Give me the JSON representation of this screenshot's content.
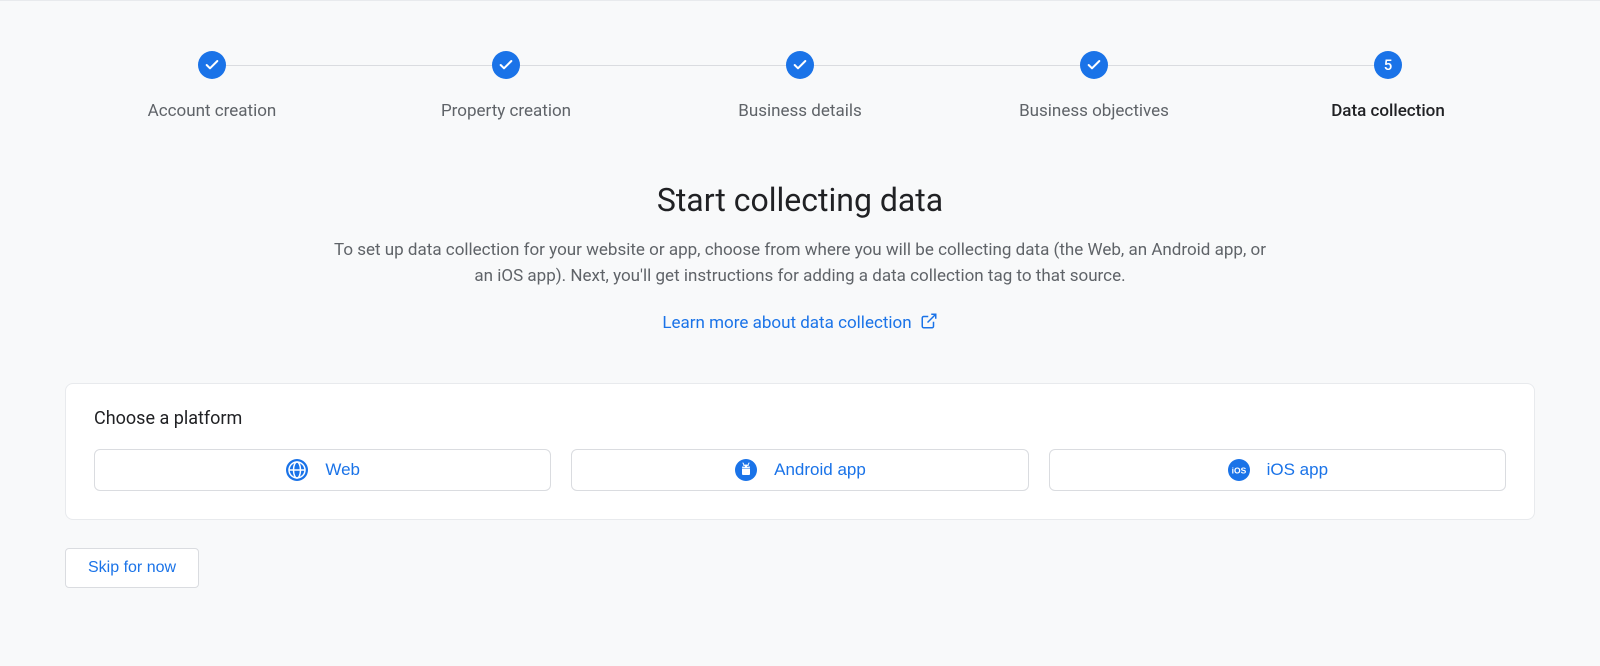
{
  "stepper": {
    "steps": [
      {
        "label": "Account creation",
        "state": "done"
      },
      {
        "label": "Property creation",
        "state": "done"
      },
      {
        "label": "Business details",
        "state": "done"
      },
      {
        "label": "Business objectives",
        "state": "done"
      },
      {
        "label": "Data collection",
        "state": "current",
        "number": "5"
      }
    ]
  },
  "main": {
    "title": "Start collecting data",
    "description": "To set up data collection for your website or app, choose from where you will be collecting data (the Web, an Android app, or an iOS app). Next, you'll get instructions for adding a data collection tag to that source.",
    "learn_more_label": "Learn more about data collection"
  },
  "platform": {
    "heading": "Choose a platform",
    "options": {
      "web": "Web",
      "android": "Android app",
      "ios": "iOS app"
    }
  },
  "actions": {
    "skip_label": "Skip for now"
  },
  "colors": {
    "primary": "#1a73e8"
  }
}
